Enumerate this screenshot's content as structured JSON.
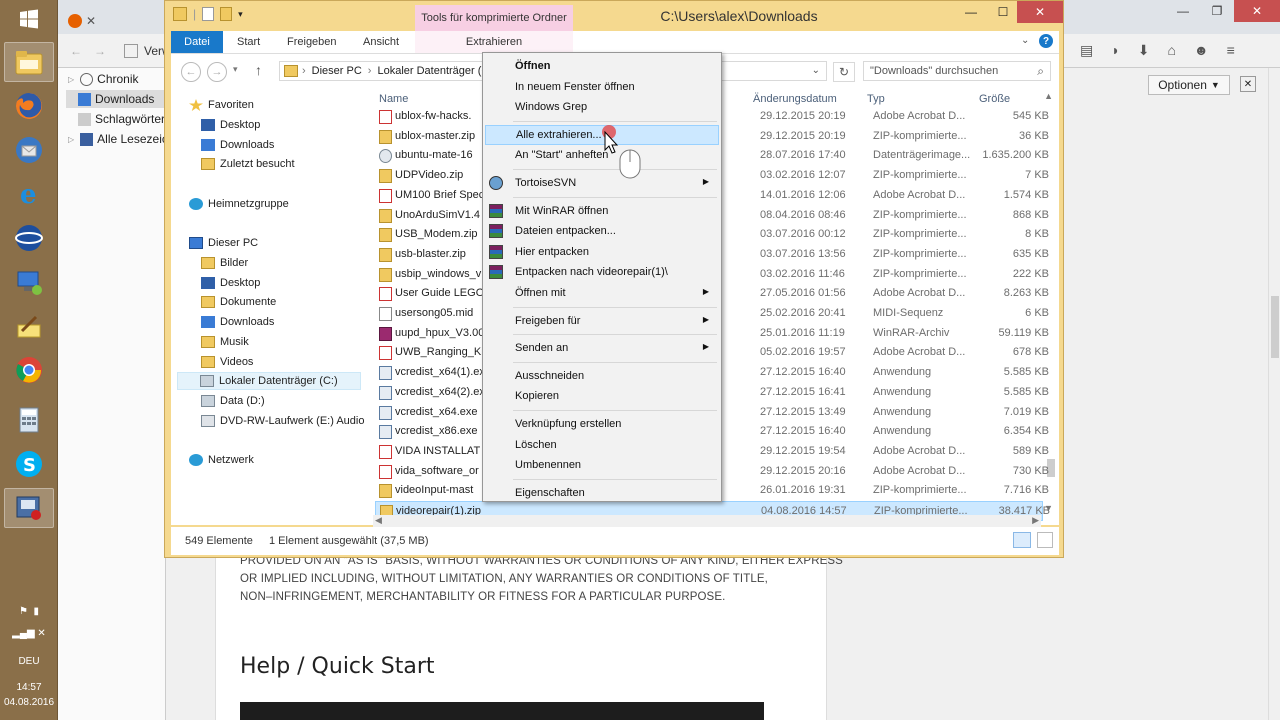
{
  "firefox": {
    "sidebar_items": [
      "Chronik",
      "Downloads",
      "Schlagwörter",
      "Alle Lesezeich"
    ],
    "options_label": "Optionen",
    "options_arrow": "▼",
    "close_symbol": "✕",
    "verw_label": "Verw",
    "page": {
      "license_lines": [
        "PROVIDED ON AN \"AS IS\" BASIS, WITHOUT WARRANTIES OR CONDITIONS OF ANY KIND, EITHER EXPRESS",
        "OR IMPLIED INCLUDING, WITHOUT LIMITATION, ANY WARRANTIES OR CONDITIONS OF TITLE,",
        "NON–INFRINGEMENT, MERCHANTABILITY OR FITNESS FOR A PARTICULAR PURPOSE."
      ],
      "help_title": "Help / Quick Start"
    }
  },
  "taskbar": {
    "language": "DEU",
    "time": "14:57",
    "date": "04.08.2016"
  },
  "explorer": {
    "title": "C:\\Users\\alex\\Downloads",
    "context_tab": "Tools für komprimierte Ordner",
    "ribbon_tabs": [
      "Datei",
      "Start",
      "Freigeben",
      "Ansicht",
      "Extrahieren"
    ],
    "address": [
      "Dieser PC",
      "Lokaler Datenträger (C:)"
    ],
    "search_placeholder": "\"Downloads\" durchsuchen",
    "columns": {
      "name": "Name",
      "date": "Änderungsdatum",
      "type": "Typ",
      "size": "Größe"
    },
    "nav": {
      "favorites": "Favoriten",
      "fav_items": [
        "Desktop",
        "Downloads",
        "Zuletzt besucht"
      ],
      "homegroup": "Heimnetzgruppe",
      "this_pc": "Dieser PC",
      "pc_items": [
        "Bilder",
        "Desktop",
        "Dokumente",
        "Downloads",
        "Musik",
        "Videos",
        "Lokaler Datenträger (C:)",
        "Data (D:)",
        "DVD-RW-Laufwerk (E:) Audio"
      ],
      "network": "Netzwerk"
    },
    "files": [
      {
        "name": "ublox-fw-hacks.",
        "date": "29.12.2015 20:19",
        "type": "Adobe Acrobat D...",
        "size": "545 KB",
        "icon": "pdf-icon"
      },
      {
        "name": "ublox-master.zip",
        "date": "29.12.2015 20:19",
        "type": "ZIP-komprimierte...",
        "size": "36 KB",
        "icon": "zip-icon"
      },
      {
        "name": "ubuntu-mate-16",
        "date": "28.07.2016 17:40",
        "type": "Datenträgerimage...",
        "size": "1.635.200 KB",
        "icon": "disc-icon"
      },
      {
        "name": "UDPVideo.zip",
        "date": "03.02.2016 12:07",
        "type": "ZIP-komprimierte...",
        "size": "7 KB",
        "icon": "zip-icon"
      },
      {
        "name": "UM100 Brief Spec",
        "date": "14.01.2016 12:06",
        "type": "Adobe Acrobat D...",
        "size": "1.574 KB",
        "icon": "pdf-icon"
      },
      {
        "name": "UnoArduSimV1.4",
        "date": "08.04.2016 08:46",
        "type": "ZIP-komprimierte...",
        "size": "868 KB",
        "icon": "zip-icon"
      },
      {
        "name": "USB_Modem.zip",
        "date": "03.07.2016 00:12",
        "type": "ZIP-komprimierte...",
        "size": "8 KB",
        "icon": "zip-icon"
      },
      {
        "name": "usb-blaster.zip",
        "date": "03.07.2016 13:56",
        "type": "ZIP-komprimierte...",
        "size": "635 KB",
        "icon": "zip-icon"
      },
      {
        "name": "usbip_windows_v",
        "date": "03.02.2016 11:46",
        "type": "ZIP-komprimierte...",
        "size": "222 KB",
        "icon": "zip-icon"
      },
      {
        "name": "User Guide LEGO",
        "date": "27.05.2016 01:56",
        "type": "Adobe Acrobat D...",
        "size": "8.263 KB",
        "icon": "pdf-icon"
      },
      {
        "name": "usersong05.mid",
        "date": "25.02.2016 20:41",
        "type": "MIDI-Sequenz",
        "size": "6 KB",
        "icon": "midi-icon"
      },
      {
        "name": "uupd_hpux_V3.00",
        "date": "25.01.2016 11:19",
        "type": "WinRAR-Archiv",
        "size": "59.119 KB",
        "icon": "rar-icon"
      },
      {
        "name": "UWB_Ranging_Ki",
        "date": "05.02.2016 19:57",
        "type": "Adobe Acrobat D...",
        "size": "678 KB",
        "icon": "pdf-icon"
      },
      {
        "name": "vcredist_x64(1).ex",
        "date": "27.12.2015 16:40",
        "type": "Anwendung",
        "size": "5.585 KB",
        "icon": "exe-icon"
      },
      {
        "name": "vcredist_x64(2).ex",
        "date": "27.12.2015 16:41",
        "type": "Anwendung",
        "size": "5.585 KB",
        "icon": "exe-icon"
      },
      {
        "name": "vcredist_x64.exe",
        "date": "27.12.2015 13:49",
        "type": "Anwendung",
        "size": "7.019 KB",
        "icon": "exe-icon"
      },
      {
        "name": "vcredist_x86.exe",
        "date": "27.12.2015 16:40",
        "type": "Anwendung",
        "size": "6.354 KB",
        "icon": "exe-icon"
      },
      {
        "name": "VIDA INSTALLAT",
        "date": "29.12.2015 19:54",
        "type": "Adobe Acrobat D...",
        "size": "589 KB",
        "icon": "pdf-icon"
      },
      {
        "name": "vida_software_or",
        "date": "29.12.2015 20:16",
        "type": "Adobe Acrobat D...",
        "size": "730 KB",
        "icon": "pdf-icon"
      },
      {
        "name": "videoInput-mast",
        "date": "26.01.2016 19:31",
        "type": "ZIP-komprimierte...",
        "size": "7.716 KB",
        "icon": "zip-icon"
      },
      {
        "name": "videorepair(1).zip",
        "date": "04.08.2016 14:57",
        "type": "ZIP-komprimierte...",
        "size": "38.417 KB",
        "icon": "zip-icon"
      }
    ],
    "status_count": "549 Elemente",
    "status_selected": "1 Element ausgewählt (37,5 MB)"
  },
  "context_menu": {
    "items": [
      {
        "label": "Öffnen",
        "bold": true
      },
      {
        "label": "In neuem Fenster öffnen"
      },
      {
        "label": "Windows Grep"
      },
      {
        "sep": true
      },
      {
        "label": "Alle extrahieren...",
        "highlight": true
      },
      {
        "label": "An \"Start\" anheften"
      },
      {
        "sep": true
      },
      {
        "label": "TortoiseSVN",
        "submenu": true,
        "icon": "tortoise-icon"
      },
      {
        "sep": true
      },
      {
        "label": "Mit WinRAR öffnen",
        "icon": "winrar-icon"
      },
      {
        "label": "Dateien entpacken...",
        "icon": "winrar-icon"
      },
      {
        "label": "Hier entpacken",
        "icon": "winrar-icon"
      },
      {
        "label": "Entpacken nach videorepair(1)\\",
        "icon": "winrar-icon"
      },
      {
        "label": "Öffnen mit",
        "submenu": true
      },
      {
        "sep": true
      },
      {
        "label": "Freigeben für",
        "submenu": true
      },
      {
        "sep": true
      },
      {
        "label": "Senden an",
        "submenu": true
      },
      {
        "sep": true
      },
      {
        "label": "Ausschneiden"
      },
      {
        "label": "Kopieren"
      },
      {
        "sep": true
      },
      {
        "label": "Verknüpfung erstellen"
      },
      {
        "label": "Löschen"
      },
      {
        "label": "Umbenennen"
      },
      {
        "sep": true
      },
      {
        "label": "Eigenschaften"
      }
    ]
  },
  "colors": {
    "explorer_frame": "#f5d98f",
    "file_tab": "#1979ca",
    "selection": "#cce8ff",
    "taskbar": "#8a6f49"
  }
}
